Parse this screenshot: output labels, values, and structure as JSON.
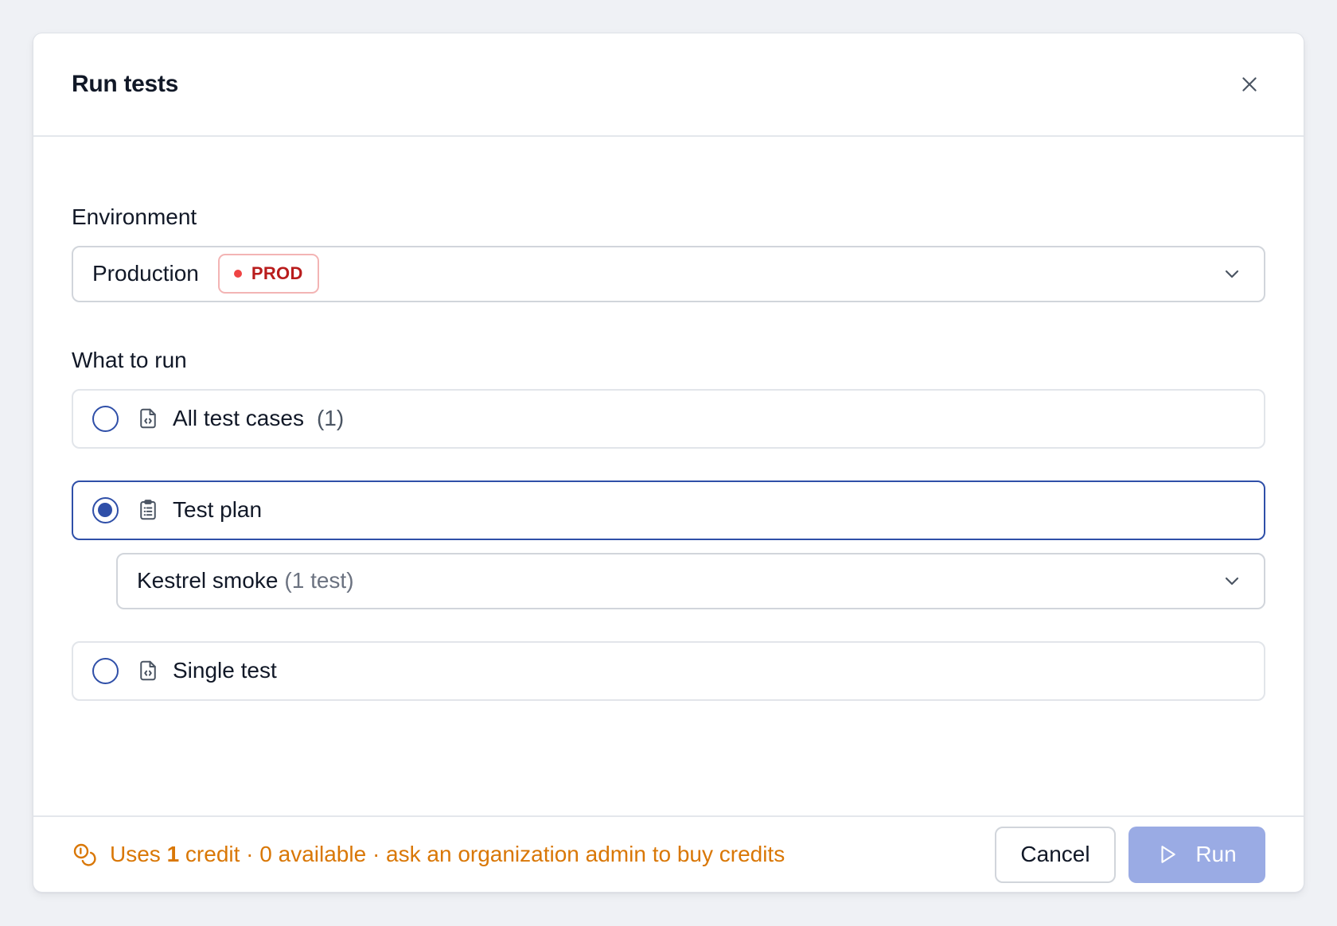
{
  "modal": {
    "title": "Run tests",
    "close_icon": "close-icon"
  },
  "environment": {
    "label": "Environment",
    "selected": "Production",
    "badge": "PROD",
    "badge_color": "#ef4444"
  },
  "what_to_run": {
    "label": "What to run",
    "options": [
      {
        "label": "All test cases",
        "count": "(1)",
        "icon": "file-code-icon",
        "selected": false
      },
      {
        "label": "Test plan",
        "icon": "clipboard-list-icon",
        "selected": true
      },
      {
        "label": "Single test",
        "icon": "file-code-icon",
        "selected": false
      }
    ],
    "plan_select": {
      "value": "Kestrel smoke",
      "hint": "(1 test)"
    }
  },
  "footer": {
    "credit_prefix": "Uses ",
    "credit_count": "1",
    "credit_suffix": " credit · 0 available · ask an organization admin to buy credits",
    "cancel_label": "Cancel",
    "run_label": "Run",
    "accent_color": "#2f4fa8",
    "warning_color": "#d97706"
  }
}
